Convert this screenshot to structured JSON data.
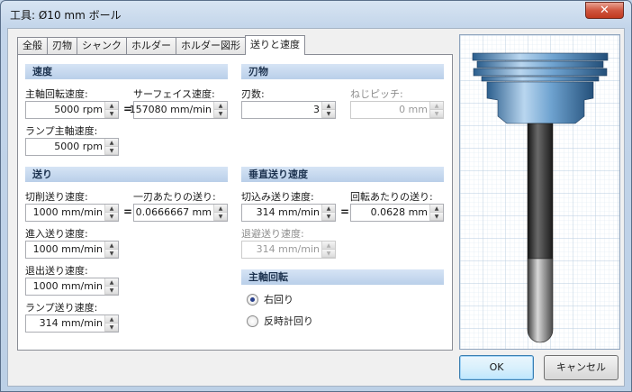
{
  "window": {
    "title": "工具: Ø10 mm ボール",
    "close_label": "✕"
  },
  "tabs": [
    "全般",
    "刃物",
    "シャンク",
    "ホルダー",
    "ホルダー図形",
    "送りと速度"
  ],
  "speed": {
    "header": "速度",
    "spindle_label": "主軸回転速度:",
    "spindle_value": "5000 rpm",
    "surface_label": "サーフェイス速度:",
    "surface_value": "157080 mm/min",
    "ramp_spindle_label": "ランプ主軸速度:",
    "ramp_spindle_value": "5000 rpm",
    "equals": "="
  },
  "flutes": {
    "header": "刃物",
    "count_label": "刃数:",
    "count_value": "3",
    "pitch_label": "ねじピッチ:",
    "pitch_value": "0 mm"
  },
  "feed": {
    "header": "送り",
    "cutting_label": "切削送り速度:",
    "cutting_value": "1000 mm/min",
    "per_tooth_label": "一刃あたりの送り:",
    "per_tooth_value": "0.0666667 mm",
    "lead_in_label": "進入送り速度:",
    "lead_in_value": "1000 mm/min",
    "lead_out_label": "退出送り速度:",
    "lead_out_value": "1000 mm/min",
    "ramp_label": "ランプ送り速度:",
    "ramp_value": "314 mm/min",
    "equals": "="
  },
  "vertical": {
    "header": "垂直送り速度",
    "plunge_label": "切込み送り速度:",
    "plunge_value": "314 mm/min",
    "per_rev_label": "回転あたりの送り:",
    "per_rev_value": "0.0628 mm",
    "retract_label": "退避送り速度:",
    "retract_value": "314 mm/min",
    "equals": "="
  },
  "rotation": {
    "header": "主軸回転",
    "cw_label": "右回り",
    "ccw_label": "反時計回り",
    "selected": "cw"
  },
  "buttons": {
    "ok": "OK",
    "cancel": "キャンセル"
  },
  "spin_up": "▲",
  "spin_down": "▼",
  "colors": {
    "section_text": "#1d3350",
    "tool_blue": "#5f97c9",
    "shank": "#2f2f2f"
  }
}
